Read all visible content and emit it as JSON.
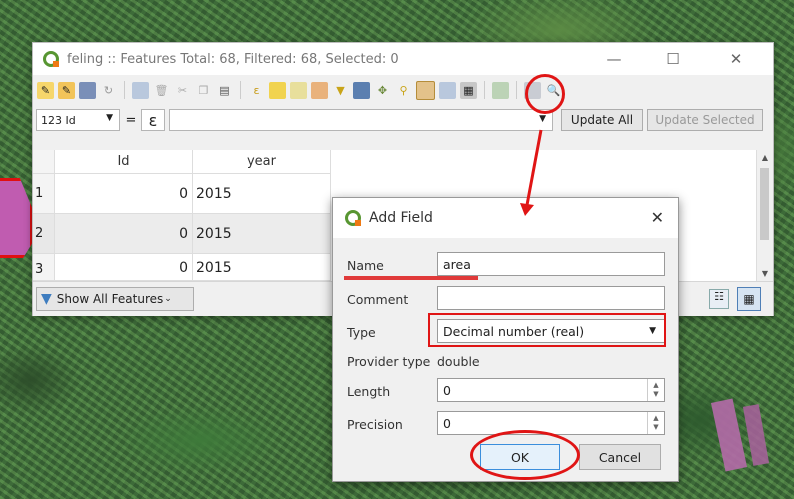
{
  "window": {
    "title": "feling :: Features Total: 68, Filtered: 68, Selected: 0",
    "minimize": "—",
    "maximize": "☐",
    "close": "✕"
  },
  "toolbar": {
    "icons": [
      "pencil-icon",
      "multi-edit-icon",
      "save-edits-icon",
      "reload-icon",
      "add-feature-icon",
      "delete-feature-icon",
      "cut-icon",
      "copy-icon",
      "paste-icon",
      "expression-select-icon",
      "select-all-icon",
      "invert-selection-icon",
      "deselect-icon",
      "filter-selection-icon",
      "move-selection-top-icon",
      "pan-to-selected-icon",
      "zoom-to-selected-icon",
      "new-field-icon",
      "delete-field-icon",
      "field-calculator-icon",
      "conditional-formatting-icon",
      "actions-icon",
      "dock-icon"
    ]
  },
  "expression_bar": {
    "field_select": "123 Id",
    "equals": "=",
    "epsilon": "ε",
    "update_all": "Update All",
    "update_selected": "Update Selected"
  },
  "table": {
    "columns": [
      "Id",
      "year"
    ],
    "rows": [
      {
        "num": "1",
        "id": "0",
        "year": "2015"
      },
      {
        "num": "2",
        "id": "0",
        "year": "2015"
      },
      {
        "num": "3",
        "id": "0",
        "year": "2015"
      }
    ]
  },
  "bottom": {
    "show_all": "Show All Features"
  },
  "dialog": {
    "title": "Add Field",
    "close": "✕",
    "name_label": "Name",
    "name_value": "area",
    "comment_label": "Comment",
    "comment_value": "",
    "type_label": "Type",
    "type_value": "Decimal number (real)",
    "provider_label": "Provider type",
    "provider_value": "double",
    "length_label": "Length",
    "length_value": "0",
    "precision_label": "Precision",
    "precision_value": "0",
    "ok": "OK",
    "cancel": "Cancel"
  },
  "colors": {
    "annotation_red": "#e01515",
    "qgis_green": "#589632",
    "qgis_orange": "#ee7913"
  }
}
